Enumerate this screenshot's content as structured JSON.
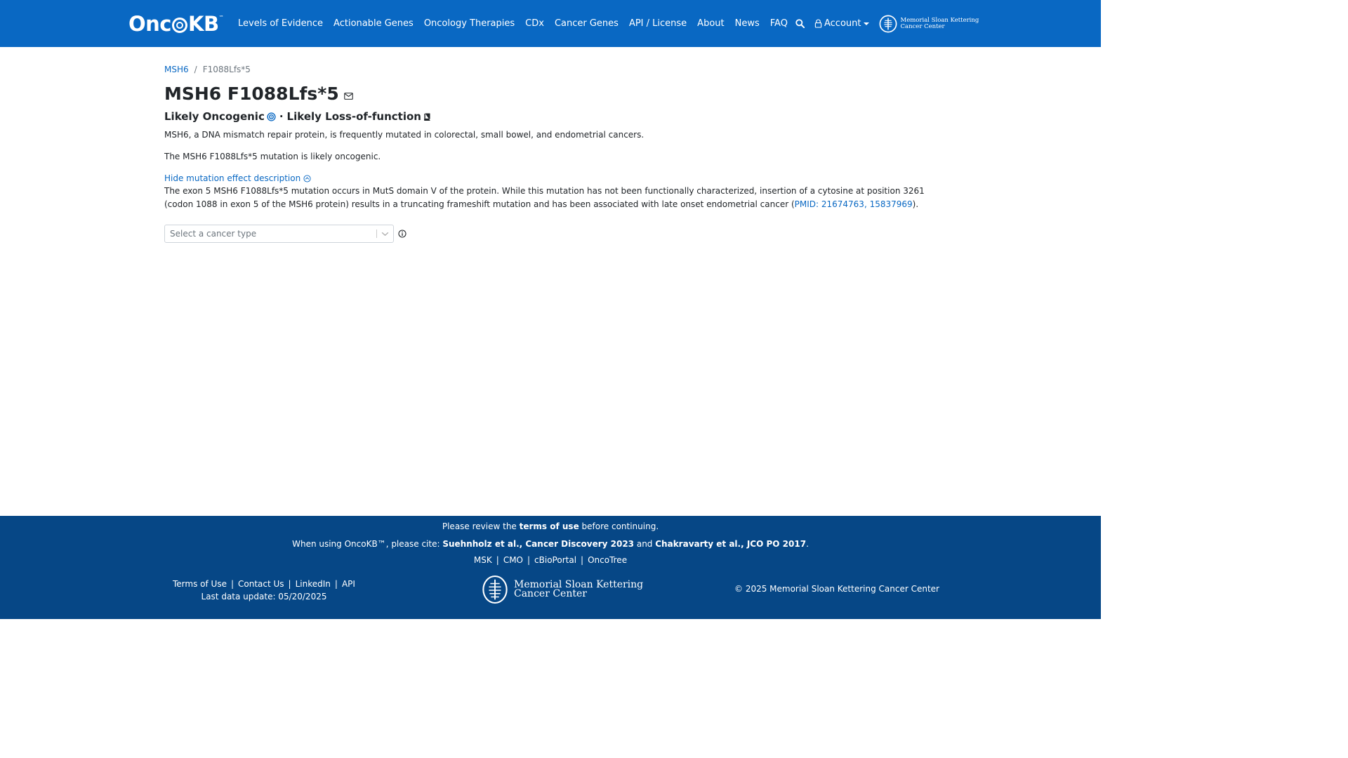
{
  "navbar": {
    "logo_text_a": "Onc",
    "logo_text_b": "KB",
    "logo_tm": "™",
    "links": [
      "Levels of Evidence",
      "Actionable Genes",
      "Oncology Therapies",
      "CDx",
      "Cancer Genes",
      "API / License",
      "About",
      "News",
      "FAQ"
    ],
    "account_label": "Account",
    "msk_line1": "Memorial Sloan Kettering",
    "msk_line2": "Cancer Center",
    "bg_color": "#0968c3"
  },
  "breadcrumb": {
    "gene": "MSH6",
    "separator": "/",
    "alteration": "F1088Lfs*5"
  },
  "page": {
    "title": "MSH6 F1088Lfs*5",
    "oncogenicity": "Likely Oncogenic",
    "dot": "·",
    "mutation_effect": "Likely Loss-of-function",
    "gene_summary": "MSH6, a DNA mismatch repair protein, is frequently mutated in colorectal, small bowel, and endometrial cancers.",
    "variant_summary": "The MSH6 F1088Lfs*5 mutation is likely oncogenic.",
    "toggle_label": "Hide mutation effect description",
    "description_text": "The exon 5 MSH6 F1088Lfs*5 mutation occurs in MutS domain V of the protein. While this mutation has not been functionally characterized, insertion of a cytosine at position 3261 (codon 1088 in exon 5 of the MSH6 protein) results in a truncating frameshift mutation and has been associated with late onset endometrial cancer (",
    "description_pmid": "PMID: 21674763, 15837969",
    "description_end": ").",
    "cancer_type_placeholder": "Select a cancer type"
  },
  "footer": {
    "review_pre": "Please review the ",
    "review_link": "terms of use",
    "review_post": " before continuing.",
    "cite_pre": "When using OncoKB™, please cite: ",
    "cite_1": "Suehnholz et al., Cancer Discovery 2023",
    "cite_and": " and ",
    "cite_2": "Chakravarty et al., JCO PO 2017",
    "cite_end": ".",
    "partner_links": [
      "MSK",
      "CMO",
      "cBioPortal",
      "OncoTree"
    ],
    "bottom_links": [
      "Terms of Use",
      "Contact Us",
      "LinkedIn",
      "API"
    ],
    "last_update": "Last data update: 05/20/2025",
    "msk_line1": "Memorial Sloan Kettering",
    "msk_line2": "Cancer Center",
    "copyright": "© 2025 Memorial Sloan Kettering Cancer Center",
    "bg_color": "#064786"
  }
}
